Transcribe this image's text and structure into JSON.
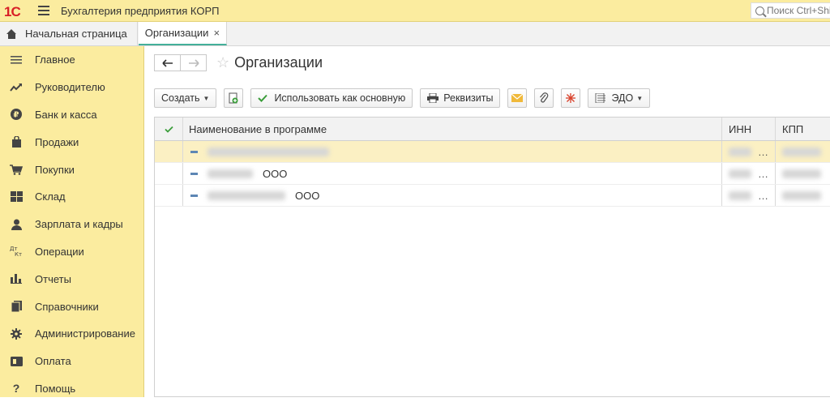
{
  "app": {
    "title": "Бухгалтерия предприятия КОРП",
    "logo_text": "1С",
    "search_placeholder": "Поиск Ctrl+Shift+F"
  },
  "tabs": {
    "home": "Начальная страница",
    "active": "Организации",
    "close_glyph": "×"
  },
  "sidebar": {
    "items": [
      {
        "label": "Главное",
        "icon": "menu-lines-icon"
      },
      {
        "label": "Руководителю",
        "icon": "trend-icon"
      },
      {
        "label": "Банк и касса",
        "icon": "ruble-icon"
      },
      {
        "label": "Продажи",
        "icon": "bag-icon"
      },
      {
        "label": "Покупки",
        "icon": "cart-icon"
      },
      {
        "label": "Склад",
        "icon": "warehouse-icon"
      },
      {
        "label": "Зарплата и кадры",
        "icon": "person-icon"
      },
      {
        "label": "Операции",
        "icon": "debit-credit-icon"
      },
      {
        "label": "Отчеты",
        "icon": "bar-chart-icon"
      },
      {
        "label": "Справочники",
        "icon": "books-icon"
      },
      {
        "label": "Администрирование",
        "icon": "gear-icon"
      },
      {
        "label": "Оплата",
        "icon": "payment-icon"
      },
      {
        "label": "Помощь",
        "icon": "question-icon"
      }
    ]
  },
  "page": {
    "title": "Организации"
  },
  "toolbar": {
    "create": "Создать",
    "use_as_main": "Использовать как основную",
    "requisites": "Реквизиты",
    "edo": "ЭДО"
  },
  "table": {
    "headers": {
      "name": "Наименование в программе",
      "inn": "ИНН",
      "kpp": "КПП"
    },
    "rows": [
      {
        "type": "",
        "inn_suffix": "…"
      },
      {
        "type": "ООО",
        "inn_suffix": "…"
      },
      {
        "type": "ООО",
        "inn_suffix": "…"
      }
    ]
  },
  "colors": {
    "sidebar_bg": "#fbec9f",
    "accent": "#44b09a",
    "logo_red": "#d81f26",
    "selected_row": "#fbf0c3"
  }
}
